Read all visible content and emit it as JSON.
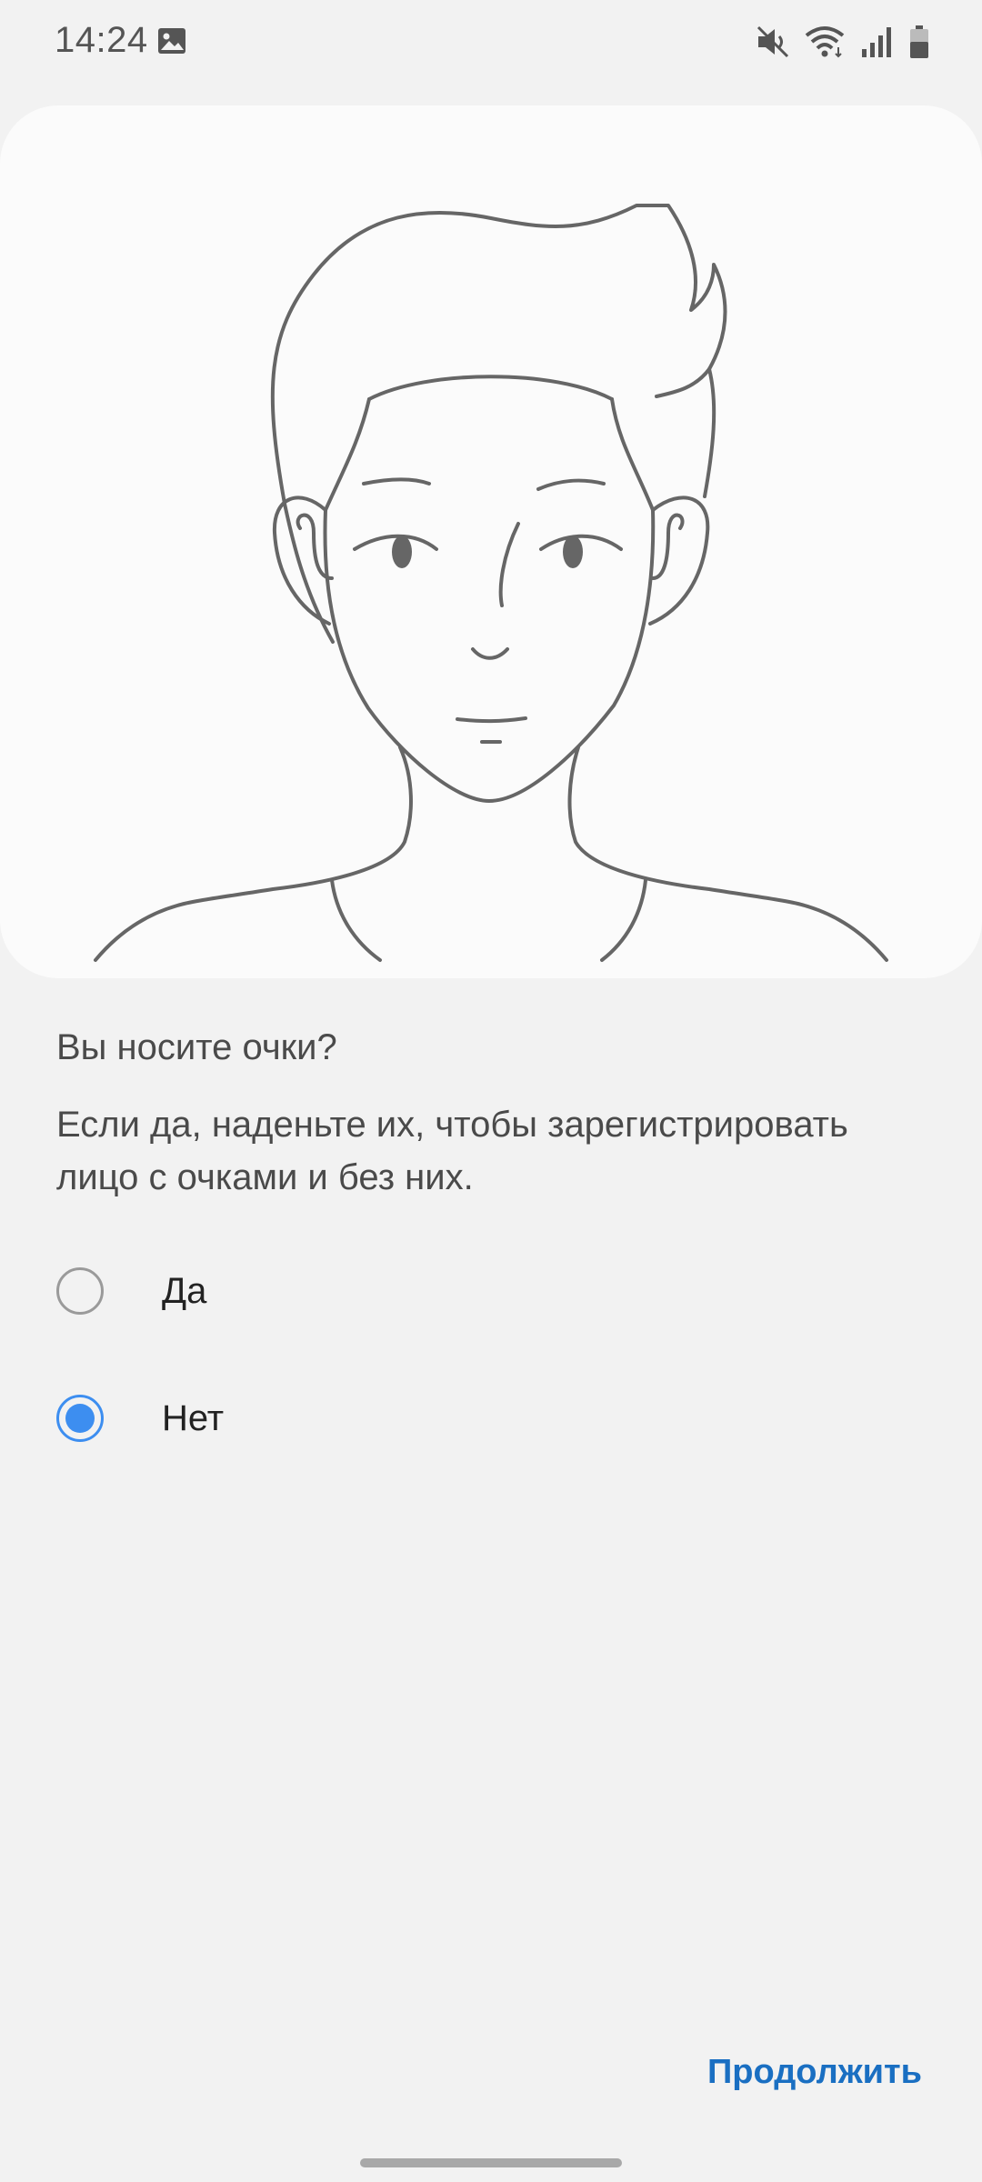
{
  "status_bar": {
    "time": "14:24",
    "icons": [
      "gallery-icon",
      "mute-icon",
      "wifi-icon",
      "signal-icon",
      "battery-icon"
    ]
  },
  "illustration": {
    "icon": "face-portrait-illustration"
  },
  "content": {
    "title": "Вы носите очки?",
    "description": "Если да, наденьте их, чтобы зарегистрировать лицо с очками и без них."
  },
  "options": [
    {
      "label": "Да",
      "selected": false
    },
    {
      "label": "Нет",
      "selected": true
    }
  ],
  "footer": {
    "continue_label": "Продолжить"
  },
  "colors": {
    "accent": "#3d8ef0",
    "button_text": "#1a6fc2",
    "background": "#f2f2f2",
    "card": "#fbfbfb"
  }
}
